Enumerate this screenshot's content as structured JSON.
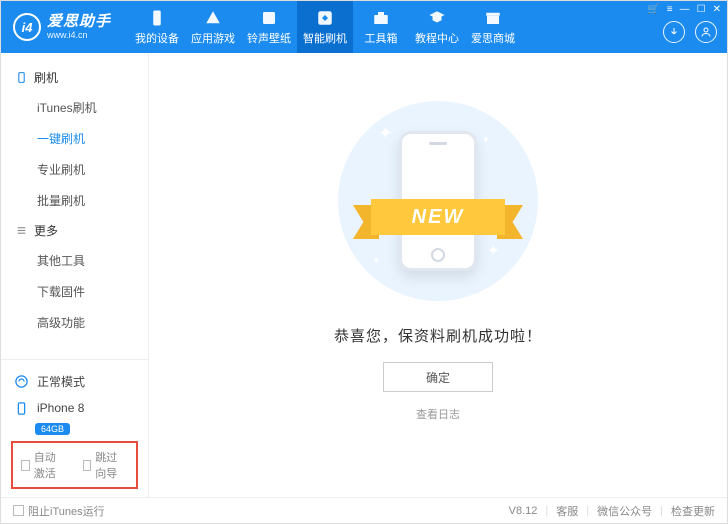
{
  "brand": {
    "logo_text": "i4",
    "title": "爱思助手",
    "url": "www.i4.cn"
  },
  "titlebar": {
    "cart": "🛒",
    "menu": "≡",
    "min": "—",
    "max": "☐",
    "close": "✕"
  },
  "nav": [
    {
      "id": "device",
      "label": "我的设备"
    },
    {
      "id": "apps",
      "label": "应用游戏"
    },
    {
      "id": "ring",
      "label": "铃声壁纸"
    },
    {
      "id": "flash",
      "label": "智能刷机",
      "active": true
    },
    {
      "id": "tools",
      "label": "工具箱"
    },
    {
      "id": "edu",
      "label": "教程中心"
    },
    {
      "id": "store",
      "label": "爱思商城"
    }
  ],
  "sidebar": {
    "sec1": {
      "title": "刷机",
      "items": [
        {
          "id": "itunes",
          "label": "iTunes刷机"
        },
        {
          "id": "onekey",
          "label": "一键刷机",
          "active": true
        },
        {
          "id": "pro",
          "label": "专业刷机"
        },
        {
          "id": "batch",
          "label": "批量刷机"
        }
      ]
    },
    "sec2": {
      "title": "更多",
      "items": [
        {
          "id": "other",
          "label": "其他工具"
        },
        {
          "id": "fw",
          "label": "下载固件"
        },
        {
          "id": "adv",
          "label": "高级功能"
        }
      ]
    },
    "mode": "正常模式",
    "device": "iPhone 8",
    "storage": "64GB",
    "opt_auto_activate": "自动激活",
    "opt_skip_guide": "跳过向导"
  },
  "main": {
    "ribbon": "NEW",
    "success": "恭喜您，保资料刷机成功啦！",
    "ok": "确定",
    "view_log": "查看日志"
  },
  "status": {
    "block_itunes": "阻止iTunes运行",
    "version": "V8.12",
    "support": "客服",
    "wechat": "微信公众号",
    "update": "检查更新"
  }
}
